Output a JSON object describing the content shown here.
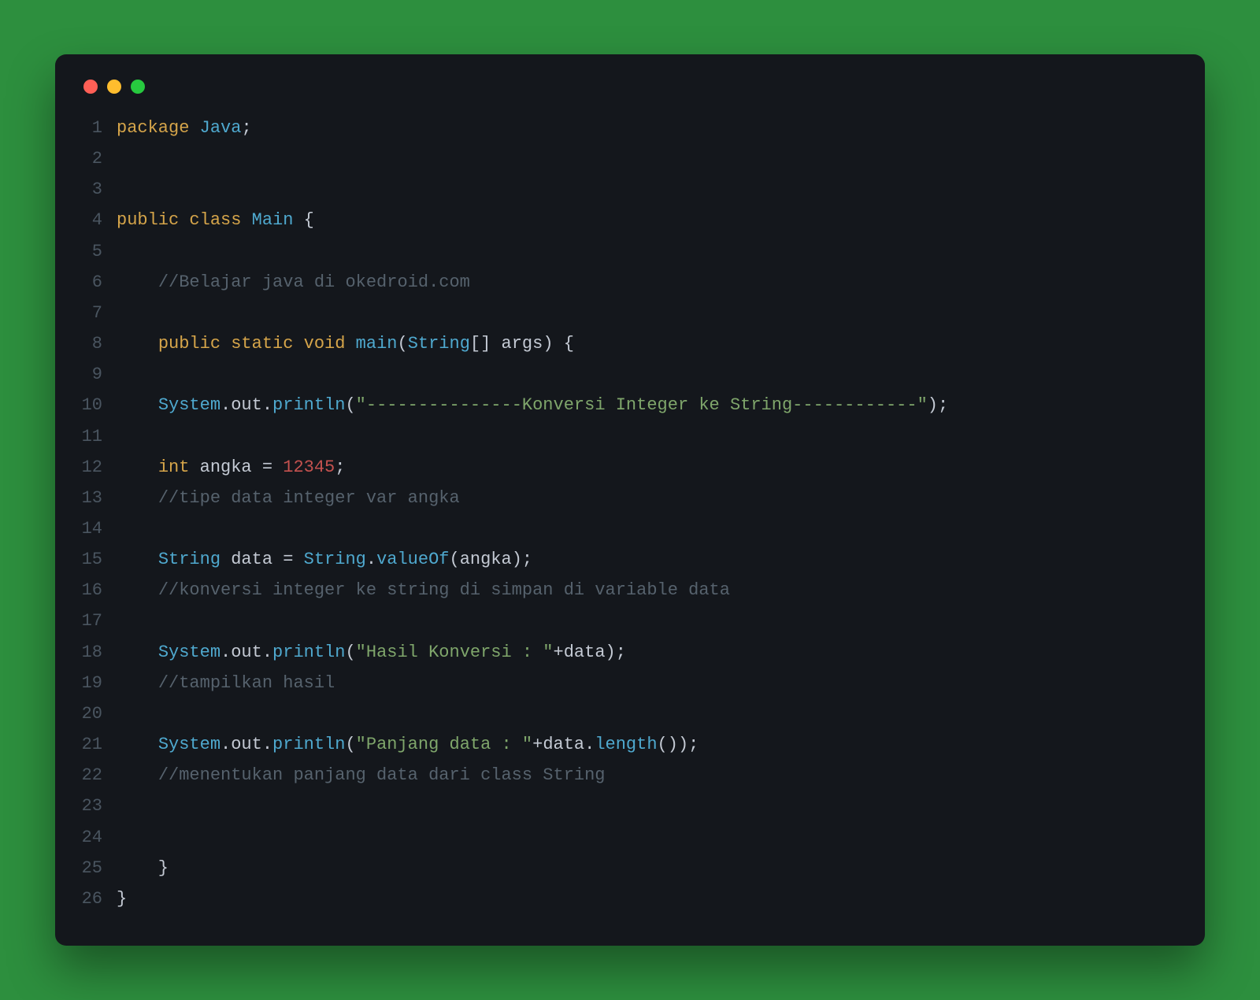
{
  "window": {
    "controls": {
      "close": "red",
      "minimize": "yellow",
      "zoom": "green"
    }
  },
  "code": {
    "language": "java",
    "line_numbers": [
      "1",
      "2",
      "3",
      "4",
      "5",
      "6",
      "7",
      "8",
      "9",
      "10",
      "11",
      "12",
      "13",
      "14",
      "15",
      "16",
      "17",
      "18",
      "19",
      "20",
      "21",
      "22",
      "23",
      "24",
      "25",
      "26"
    ],
    "lines": [
      [
        {
          "t": "package ",
          "c": "kw"
        },
        {
          "t": "Java",
          "c": "type"
        },
        {
          "t": ";",
          "c": "pun"
        }
      ],
      [],
      [],
      [
        {
          "t": "public ",
          "c": "kw"
        },
        {
          "t": "class ",
          "c": "kw"
        },
        {
          "t": "Main ",
          "c": "type"
        },
        {
          "t": "{",
          "c": "pun"
        }
      ],
      [],
      [
        {
          "t": "    ",
          "c": "pun"
        },
        {
          "t": "//Belajar java di okedroid.com",
          "c": "cm"
        }
      ],
      [],
      [
        {
          "t": "    ",
          "c": "pun"
        },
        {
          "t": "public ",
          "c": "kw"
        },
        {
          "t": "static ",
          "c": "kw"
        },
        {
          "t": "void ",
          "c": "kw"
        },
        {
          "t": "main",
          "c": "fn"
        },
        {
          "t": "(",
          "c": "pun"
        },
        {
          "t": "String",
          "c": "type"
        },
        {
          "t": "[] ",
          "c": "pun"
        },
        {
          "t": "args",
          "c": "var"
        },
        {
          "t": ") {",
          "c": "pun"
        }
      ],
      [],
      [
        {
          "t": "    ",
          "c": "pun"
        },
        {
          "t": "System",
          "c": "type"
        },
        {
          "t": ".",
          "c": "pun"
        },
        {
          "t": "out",
          "c": "var"
        },
        {
          "t": ".",
          "c": "pun"
        },
        {
          "t": "println",
          "c": "fn"
        },
        {
          "t": "(",
          "c": "pun"
        },
        {
          "t": "\"---------------Konversi Integer ke String------------\"",
          "c": "str"
        },
        {
          "t": ");",
          "c": "pun"
        }
      ],
      [],
      [
        {
          "t": "    ",
          "c": "pun"
        },
        {
          "t": "int ",
          "c": "kw"
        },
        {
          "t": "angka ",
          "c": "var"
        },
        {
          "t": "= ",
          "c": "op"
        },
        {
          "t": "12345",
          "c": "num"
        },
        {
          "t": ";",
          "c": "pun"
        }
      ],
      [
        {
          "t": "    ",
          "c": "pun"
        },
        {
          "t": "//tipe data integer var angka",
          "c": "cm"
        }
      ],
      [],
      [
        {
          "t": "    ",
          "c": "pun"
        },
        {
          "t": "String ",
          "c": "type"
        },
        {
          "t": "data ",
          "c": "var"
        },
        {
          "t": "= ",
          "c": "op"
        },
        {
          "t": "String",
          "c": "type"
        },
        {
          "t": ".",
          "c": "pun"
        },
        {
          "t": "valueOf",
          "c": "fn"
        },
        {
          "t": "(",
          "c": "pun"
        },
        {
          "t": "angka",
          "c": "var"
        },
        {
          "t": ");",
          "c": "pun"
        }
      ],
      [
        {
          "t": "    ",
          "c": "pun"
        },
        {
          "t": "//konversi integer ke string di simpan di variable data",
          "c": "cm"
        }
      ],
      [],
      [
        {
          "t": "    ",
          "c": "pun"
        },
        {
          "t": "System",
          "c": "type"
        },
        {
          "t": ".",
          "c": "pun"
        },
        {
          "t": "out",
          "c": "var"
        },
        {
          "t": ".",
          "c": "pun"
        },
        {
          "t": "println",
          "c": "fn"
        },
        {
          "t": "(",
          "c": "pun"
        },
        {
          "t": "\"Hasil Konversi : \"",
          "c": "str"
        },
        {
          "t": "+",
          "c": "op"
        },
        {
          "t": "data",
          "c": "var"
        },
        {
          "t": ");",
          "c": "pun"
        }
      ],
      [
        {
          "t": "    ",
          "c": "pun"
        },
        {
          "t": "//tampilkan hasil",
          "c": "cm"
        }
      ],
      [],
      [
        {
          "t": "    ",
          "c": "pun"
        },
        {
          "t": "System",
          "c": "type"
        },
        {
          "t": ".",
          "c": "pun"
        },
        {
          "t": "out",
          "c": "var"
        },
        {
          "t": ".",
          "c": "pun"
        },
        {
          "t": "println",
          "c": "fn"
        },
        {
          "t": "(",
          "c": "pun"
        },
        {
          "t": "\"Panjang data : \"",
          "c": "str"
        },
        {
          "t": "+",
          "c": "op"
        },
        {
          "t": "data",
          "c": "var"
        },
        {
          "t": ".",
          "c": "pun"
        },
        {
          "t": "length",
          "c": "fn"
        },
        {
          "t": "());",
          "c": "pun"
        }
      ],
      [
        {
          "t": "    ",
          "c": "pun"
        },
        {
          "t": "//menentukan panjang data dari class String",
          "c": "cm"
        }
      ],
      [],
      [],
      [
        {
          "t": "    }",
          "c": "pun"
        }
      ],
      [
        {
          "t": "}",
          "c": "pun"
        }
      ]
    ]
  }
}
